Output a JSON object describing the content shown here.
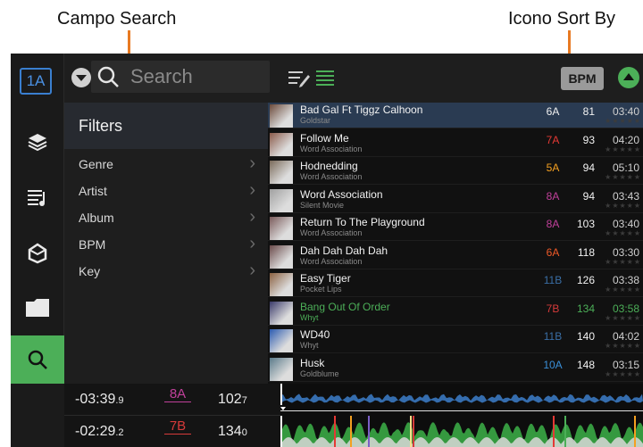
{
  "annotations": {
    "search_label": "Campo Search",
    "sort_label": "Icono Sort By"
  },
  "rail": {
    "deck_badge": "1A",
    "items": [
      "records-icon",
      "playlist-icon",
      "crates-icon",
      "folder-icon",
      "search-icon"
    ],
    "active": "search-icon"
  },
  "search": {
    "placeholder": "Search"
  },
  "sort": {
    "label": "BPM"
  },
  "filters": {
    "title": "Filters",
    "items": [
      "Genre",
      "Artist",
      "Album",
      "BPM",
      "Key"
    ]
  },
  "tracks": [
    {
      "title": "Bad Gal Ft Tiggz Calhoon",
      "artist": "Goldstar",
      "key": "6A",
      "key_color": "#f0f0f0",
      "bpm": "81",
      "time": "03:40",
      "selected": true
    },
    {
      "title": "Follow Me",
      "artist": "Word Association",
      "key": "7A",
      "key_color": "#e53935",
      "bpm": "93",
      "time": "04:20"
    },
    {
      "title": "Hodnedding",
      "artist": "Word Association",
      "key": "5A",
      "key_color": "#f4a020",
      "bpm": "94",
      "time": "05:10"
    },
    {
      "title": "Word Association",
      "artist": "Silent Movie",
      "key": "8A",
      "key_color": "#c0409a",
      "bpm": "94",
      "time": "03:43"
    },
    {
      "title": "Return To The Playground",
      "artist": "Word Association",
      "key": "8A",
      "key_color": "#c0409a",
      "bpm": "103",
      "time": "03:40"
    },
    {
      "title": "Dah Dah Dah Dah",
      "artist": "Word Association",
      "key": "6A",
      "key_color": "#f05a28",
      "bpm": "118",
      "time": "03:30"
    },
    {
      "title": "Easy Tiger",
      "artist": "Pocket Lips",
      "key": "11B",
      "key_color": "#3a6ea5",
      "bpm": "126",
      "time": "03:38"
    },
    {
      "title": "Bang Out Of Order",
      "artist": "Whyt",
      "key": "7B",
      "key_color": "#d63a3a",
      "bpm": "134",
      "time": "03:58",
      "playing": true
    },
    {
      "title": "WD40",
      "artist": "Whyt",
      "key": "11B",
      "key_color": "#3a6ea5",
      "bpm": "140",
      "time": "04:02"
    },
    {
      "title": "Husk",
      "artist": "Goldblume",
      "key": "10A",
      "key_color": "#3a8fd8",
      "bpm": "148",
      "time": "03:15"
    }
  ],
  "decks": [
    {
      "time": "-03:39",
      "time_frac": ".9",
      "key": "8A",
      "key_color": "#c0409a",
      "bpm": "102",
      "bpm_frac": "7"
    },
    {
      "time": "-02:29",
      "time_frac": ".2",
      "key": "7B",
      "key_color": "#d63a3a",
      "bpm": "134",
      "bpm_frac": "0"
    }
  ],
  "colors": {
    "accent_green": "#4caf58",
    "deck_blue": "#3a7fd0",
    "arrow": "#e87a22",
    "playing": "#4caf58"
  }
}
